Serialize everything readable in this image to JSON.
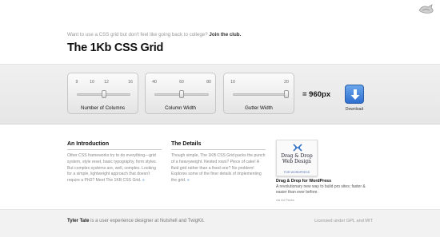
{
  "header": {
    "intro_text": "Want to use a CSS grid but don't feel like going back to college?",
    "intro_link": "Join the club.",
    "title": "The 1Kb CSS Grid"
  },
  "controls": {
    "columns": {
      "label": "Number of Columns",
      "ticks": [
        "9",
        "10",
        "12",
        "16"
      ],
      "value": 12
    },
    "column_width": {
      "label": "Column Width",
      "ticks": [
        "40",
        "60",
        "80"
      ],
      "value": 60
    },
    "gutter_width": {
      "label": "Gutter Width",
      "ticks": [
        "10",
        "20"
      ],
      "value": 20
    },
    "total": "= 960px",
    "download_label": "Download"
  },
  "sections": {
    "introduction": {
      "title": "An Introduction",
      "body": "Other CSS frameworks try to do everything—grid system, style reset, basic typography, form styles. But complex systems are, well, complex. Looking for a simple, lightweight approach that doesn't require a PhD? Meet The 1KB CSS Grid.",
      "arrow": "»"
    },
    "details": {
      "title": "The Details",
      "body": "Though simple, The 1KB CSS Grid packs the punch of a heavyweight. Nested rows? Piece of cake! A fluid grid rather than a fixed one? No problem! Explores some of the finer details of implementing the grid.",
      "arrow": "»"
    }
  },
  "ad": {
    "image_line1": "Drag & Drop",
    "image_line2": "Web Design",
    "image_line3": "FOR WORDPRESS",
    "title": "Drag & Drop for WordPress",
    "description": "A revolutionary new way to build pro sites; faster & easier than ever before.",
    "via": "via Ad Packs"
  },
  "footer": {
    "author": "Tyler Tate",
    "bio": "is a user experience designer at Nutshell and TwigKit.",
    "license": "Licensed under GPL and MIT"
  },
  "colors": {
    "accent": "#3a77c9",
    "download_button": "#4a8ae0"
  }
}
